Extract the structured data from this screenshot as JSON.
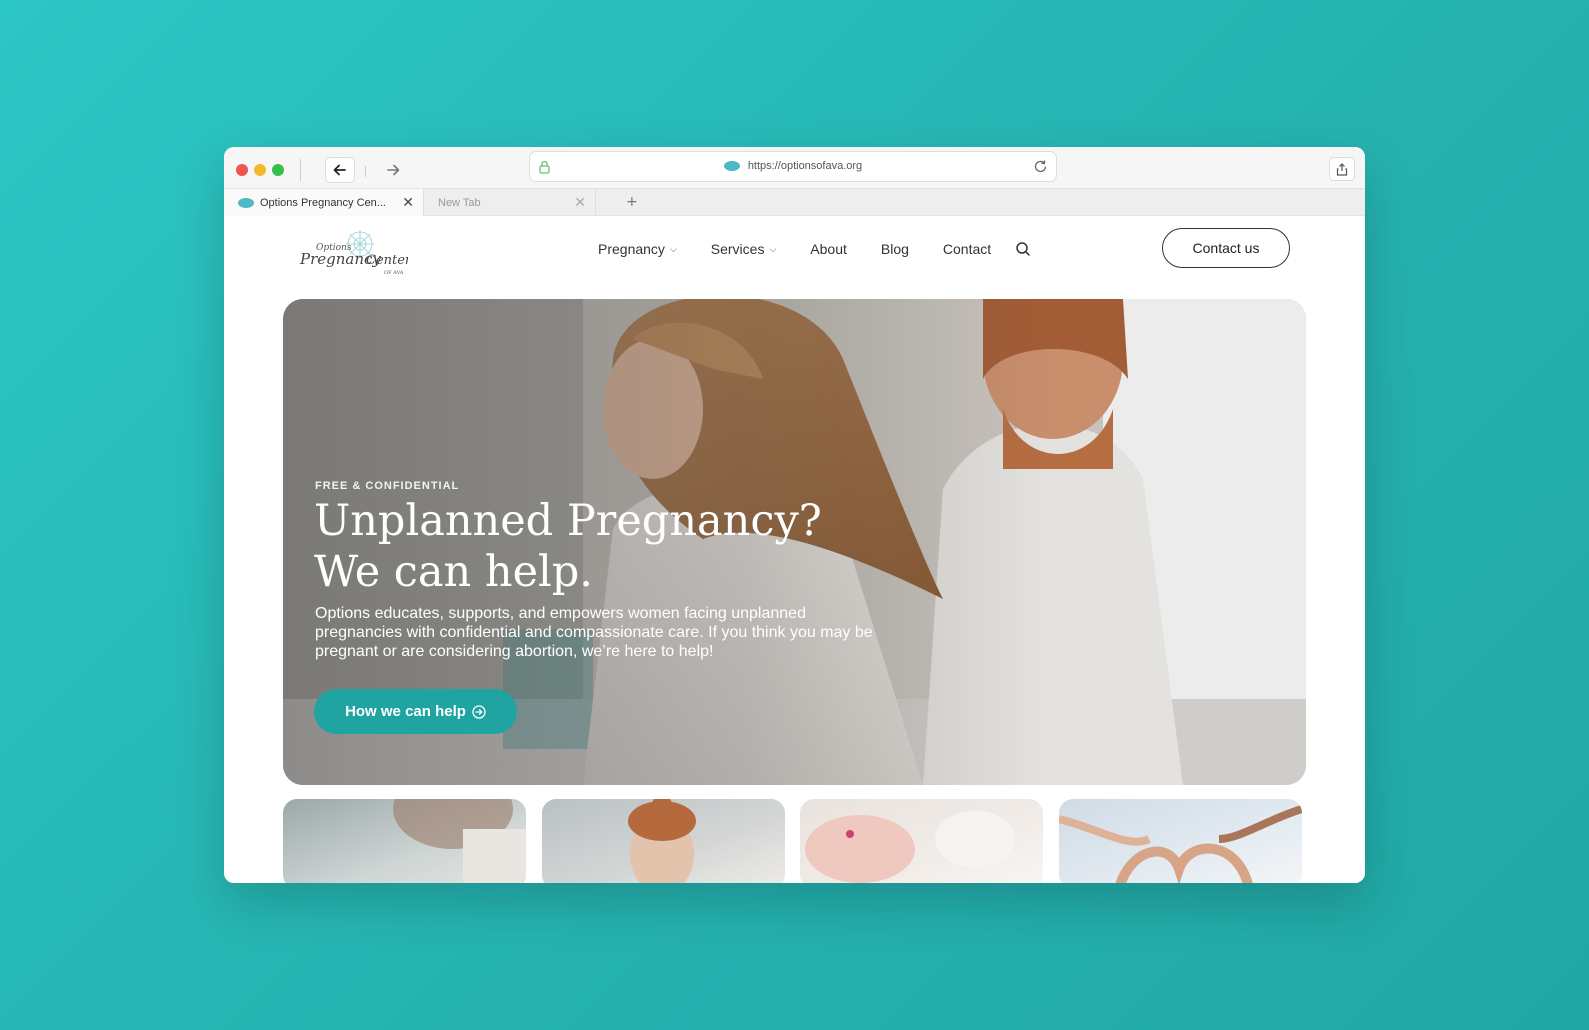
{
  "browser": {
    "url": "https://optionsofava.org",
    "tabs": [
      {
        "label": "Options Pregnancy Cen...",
        "active": true
      },
      {
        "label": "New Tab",
        "active": false
      }
    ],
    "new_tab_label": "+",
    "close_glyph": "✕"
  },
  "site": {
    "logo_alt": "Options Pregnancy Center of Ava",
    "nav": [
      {
        "label": "Pregnancy",
        "has_dropdown": true
      },
      {
        "label": "Services",
        "has_dropdown": true
      },
      {
        "label": "About",
        "has_dropdown": false
      },
      {
        "label": "Blog",
        "has_dropdown": false
      },
      {
        "label": "Contact",
        "has_dropdown": false
      }
    ],
    "contact_button": "Contact us"
  },
  "hero": {
    "eyebrow": "FREE & CONFIDENTIAL",
    "title_line1": "Unplanned Pregnancy?",
    "title_line2": "We can help.",
    "description": "Options educates, supports, and empowers women facing unplanned pregnancies with confidential and compassionate care. If you think you may be pregnant or are considering abortion, we’re here to help!",
    "cta_label": "How we can help"
  },
  "colors": {
    "accent": "#1fa4a2",
    "background": "#27b8b6"
  },
  "icons": {
    "back": "arrow-left-icon",
    "forward": "arrow-right-icon",
    "lock": "lock-icon",
    "reload": "reload-icon",
    "share": "share-icon",
    "search": "search-icon",
    "cta": "arrow-circle-right-icon"
  }
}
